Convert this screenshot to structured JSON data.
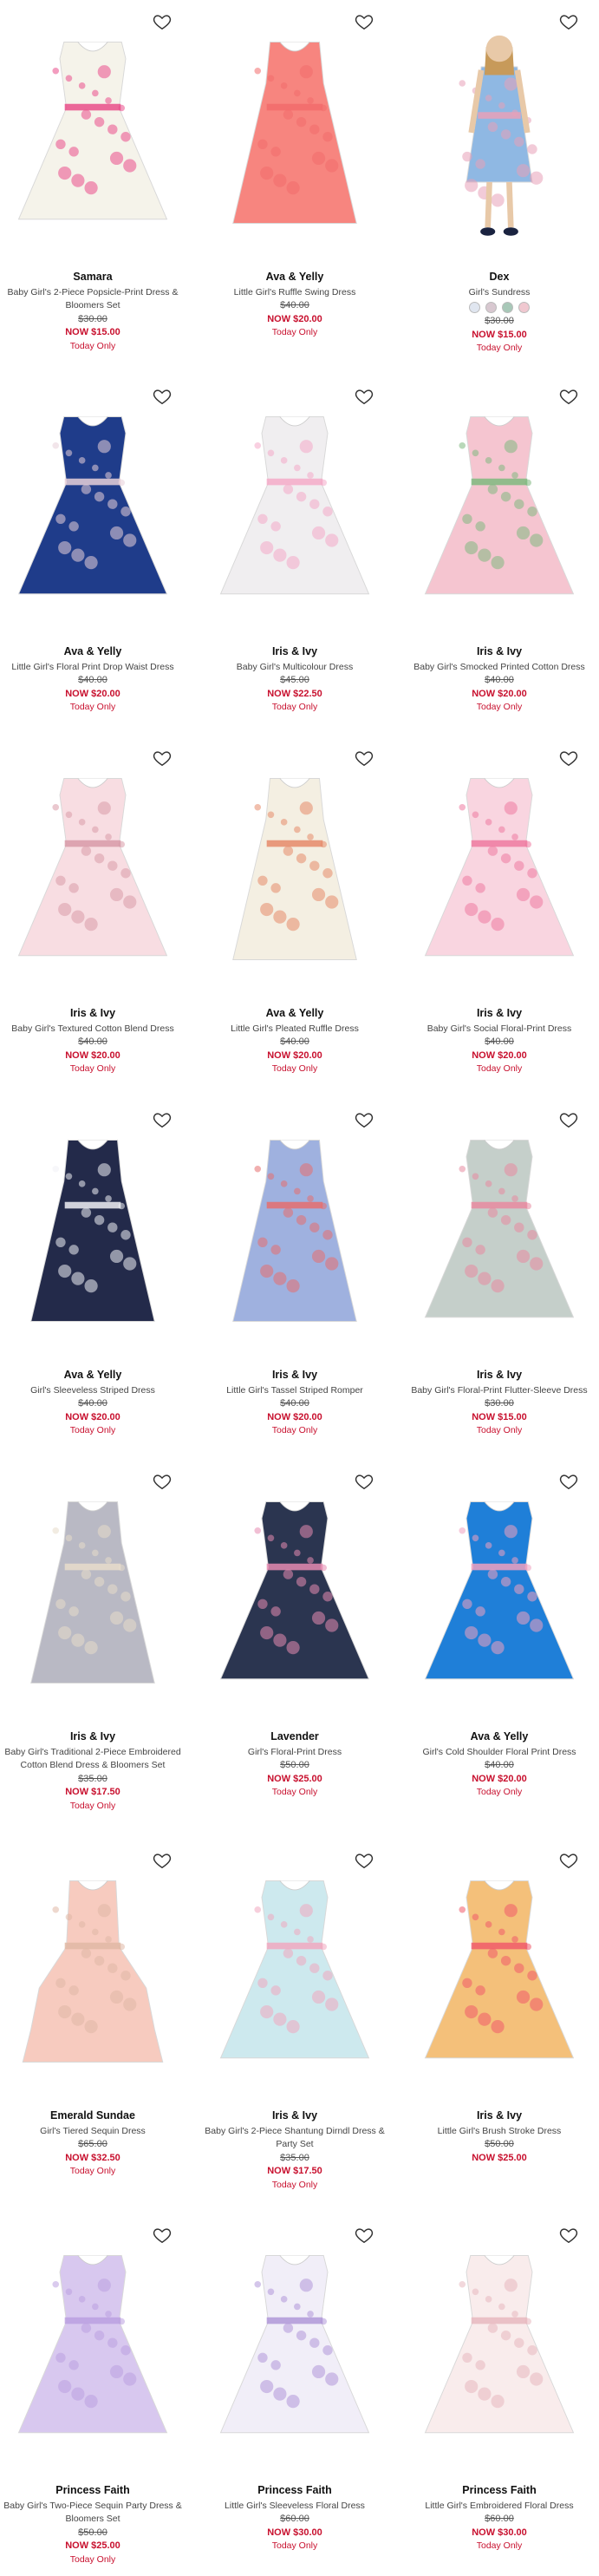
{
  "products": [
    {
      "brand": "Samara",
      "name": "Baby Girl's 2-Piece Popsicle-Print Dress & Bloomers Set",
      "orig": "$30.00",
      "now": "NOW $15.00",
      "badge": "Today Only",
      "dress": "#f5f3ea",
      "accent": "#e94d8a",
      "style": "flare"
    },
    {
      "brand": "Ava & Yelly",
      "name": "Little Girl's Ruffle Swing Dress",
      "orig": "$40.00",
      "now": "NOW $20.00",
      "badge": "Today Only",
      "dress": "#f7857f",
      "accent": "#f26b6b",
      "style": "aline"
    },
    {
      "brand": "Dex",
      "name": "Girl's Sundress",
      "orig": "$30.00",
      "now": "NOW $15.00",
      "badge": "Today Only",
      "dress": "#8fb8e3",
      "accent": "#e8a0b8",
      "style": "model",
      "swatches": [
        "#e0e6f0",
        "#d8c8d0",
        "#a8c8b8",
        "#f0c8d0"
      ]
    },
    {
      "brand": "Ava & Yelly",
      "name": "Little Girl's Floral Print Drop Waist Dress",
      "orig": "$40.00",
      "now": "NOW $20.00",
      "badge": "Today Only",
      "dress": "#1f3c8a",
      "accent": "#e8d0d8",
      "style": "flare"
    },
    {
      "brand": "Iris & Ivy",
      "name": "Baby Girl's Multicolour Dress",
      "orig": "$45.00",
      "now": "NOW $22.50",
      "badge": "Today Only",
      "dress": "#f0eef0",
      "accent": "#f4aac8",
      "style": "flare"
    },
    {
      "brand": "Iris & Ivy",
      "name": "Baby Girl's Smocked Printed Cotton Dress",
      "orig": "$40.00",
      "now": "NOW $20.00",
      "badge": "Today Only",
      "dress": "#f5c5d0",
      "accent": "#7fb87f",
      "style": "flare"
    },
    {
      "brand": "Iris & Ivy",
      "name": "Baby Girl's Textured Cotton Blend Dress",
      "orig": "$40.00",
      "now": "NOW $20.00",
      "badge": "Today Only",
      "dress": "#f8dde2",
      "accent": "#d89aa8",
      "style": "flare"
    },
    {
      "brand": "Ava & Yelly",
      "name": "Little Girl's Pleated Ruffle Dress",
      "orig": "$40.00",
      "now": "NOW $20.00",
      "badge": "Today Only",
      "dress": "#f4efe2",
      "accent": "#e58a6a",
      "style": "aline"
    },
    {
      "brand": "Iris & Ivy",
      "name": "Baby Girl's Social Floral-Print Dress",
      "orig": "$40.00",
      "now": "NOW $20.00",
      "badge": "Today Only",
      "dress": "#f9d5e0",
      "accent": "#ee7aa0",
      "style": "flare"
    },
    {
      "brand": "Ava & Yelly",
      "name": "Girl's Sleeveless Striped Dress",
      "orig": "$40.00",
      "now": "NOW $20.00",
      "badge": "Today Only",
      "dress": "#232a4a",
      "accent": "#f0f0f5",
      "style": "aline"
    },
    {
      "brand": "Iris & Ivy",
      "name": "Little Girl's Tassel Striped Romper",
      "orig": "$40.00",
      "now": "NOW $20.00",
      "badge": "Today Only",
      "dress": "#9fb1df",
      "accent": "#e56e6e",
      "style": "aline"
    },
    {
      "brand": "Iris & Ivy",
      "name": "Baby Girl's Floral-Print Flutter-Sleeve Dress",
      "orig": "$30.00",
      "now": "NOW $15.00",
      "badge": "Today Only",
      "dress": "#c5cfca",
      "accent": "#e88aa0",
      "style": "flare"
    },
    {
      "brand": "Iris & Ivy",
      "name": "Baby Girl's Traditional 2-Piece Embroidered Cotton Blend Dress & Bloomers Set",
      "orig": "$35.00",
      "now": "NOW $17.50",
      "badge": "Today Only",
      "dress": "#b9b9c4",
      "accent": "#e8dccb",
      "style": "aline"
    },
    {
      "brand": "Lavender",
      "name": "Girl's Floral-Print Dress",
      "orig": "$50.00",
      "now": "NOW $25.00",
      "badge": "Today Only",
      "dress": "#2b3550",
      "accent": "#e58ab0",
      "style": "flare"
    },
    {
      "brand": "Ava & Yelly",
      "name": "Girl's Cold Shoulder Floral Print Dress",
      "orig": "$40.00",
      "now": "NOW $20.00",
      "badge": "Today Only",
      "dress": "#1f7fd8",
      "accent": "#f0a0c0",
      "style": "flare"
    },
    {
      "brand": "Emerald Sundae",
      "name": "Girl's Tiered Sequin Dress",
      "orig": "$65.00",
      "now": "NOW $32.50",
      "badge": "Today Only",
      "dress": "#f7cbbf",
      "accent": "#e0b8a5",
      "style": "tier"
    },
    {
      "brand": "Iris & Ivy",
      "name": "Baby Girl's 2-Piece Shantung Dirndl Dress & Party Set",
      "orig": "$35.00",
      "now": "NOW $17.50",
      "badge": "Today Only",
      "dress": "#cde9ee",
      "accent": "#f0a8c0",
      "style": "flare"
    },
    {
      "brand": "Iris & Ivy",
      "name": "Little Girl's Brush Stroke Dress",
      "orig": "$50.00",
      "now": "NOW $25.00",
      "badge": "",
      "dress": "#f4c07a",
      "accent": "#f05a6a",
      "style": "flare"
    },
    {
      "brand": "Princess Faith",
      "name": "Baby Girl's Two-Piece Sequin Party Dress & Bloomers Set",
      "orig": "$50.00",
      "now": "NOW $25.00",
      "badge": "Today Only",
      "dress": "#d8c8ef",
      "accent": "#bba0e0",
      "style": "flare"
    },
    {
      "brand": "Princess Faith",
      "name": "Little Girl's Sleeveless Floral Dress",
      "orig": "$60.00",
      "now": "NOW $30.00",
      "badge": "Today Only",
      "dress": "#f1eef8",
      "accent": "#b098d8",
      "style": "flare"
    },
    {
      "brand": "Princess Faith",
      "name": "Little Girl's Embroidered Floral Dress",
      "orig": "$60.00",
      "now": "NOW $30.00",
      "badge": "Today Only",
      "dress": "#f9ecec",
      "accent": "#e8b8c0",
      "style": "flare"
    }
  ],
  "icons": {
    "wishlist": "heart-outline-icon"
  }
}
